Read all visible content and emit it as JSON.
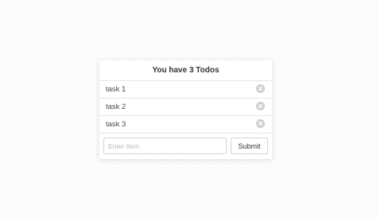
{
  "todo_card": {
    "title": "You have 3 Todos",
    "items": [
      {
        "label": "task 1",
        "remove_icon": "close-circle-icon"
      },
      {
        "label": "task 2",
        "remove_icon": "close-circle-icon"
      },
      {
        "label": "task 3",
        "remove_icon": "close-circle-icon"
      }
    ],
    "input": {
      "value": "",
      "placeholder": "Enter Item"
    },
    "submit_label": "Submit"
  },
  "colors": {
    "background": "#fdfdfd",
    "card": "#ffffff",
    "border": "#e6e6e6",
    "remove_icon": "#cfcfcf",
    "text": "#333333"
  }
}
